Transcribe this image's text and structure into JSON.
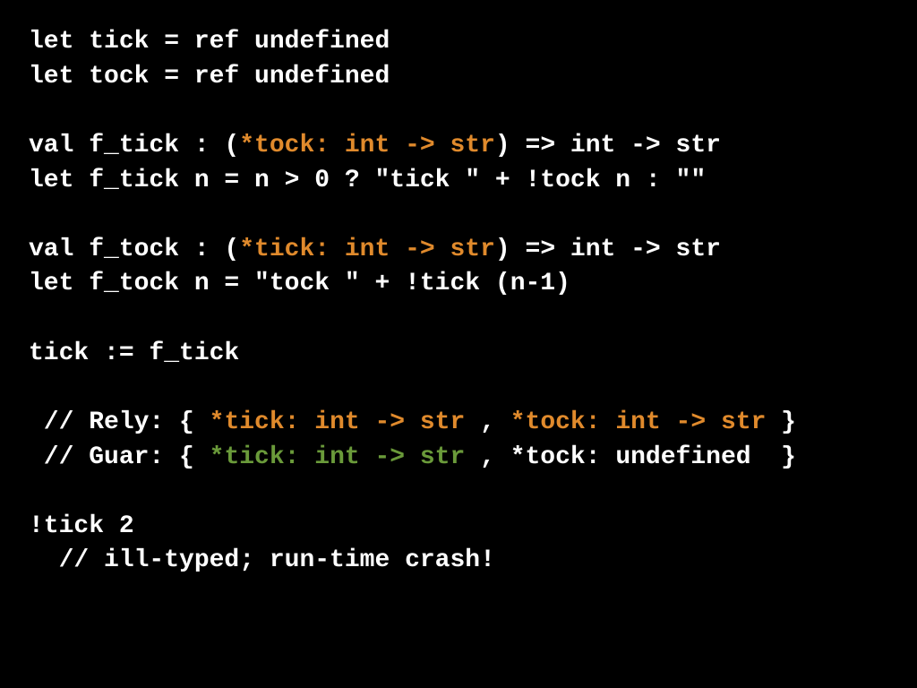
{
  "colors": {
    "bg": "#000000",
    "fg": "#ffffff",
    "orange": "#e08a2c",
    "green": "#6a9a3a"
  },
  "code": {
    "l1": "let tick = ref undefined",
    "l2": "let tock = ref undefined",
    "l3": "",
    "l4a": "val f_tick : (",
    "l4b": "*tock: int -> str",
    "l4c": ") => int -> str",
    "l5": "let f_tick n = n > 0 ? \"tick \" + !tock n : \"\"",
    "l6": "",
    "l7a": "val f_tock : (",
    "l7b": "*tick: int -> str",
    "l7c": ") => int -> str",
    "l8": "let f_tock n = \"tock \" + !tick (n-1)",
    "l9": "",
    "l10": "tick := f_tick",
    "l11": "",
    "l12a": " // Rely: { ",
    "l12b": "*tick: int -> str",
    "l12c": " , ",
    "l12d": "*tock: int -> str",
    "l12e": " }",
    "l13a": " // Guar: { ",
    "l13b": "*tick: int -> str",
    "l13c": " , *tock: undefined  }",
    "l14": "",
    "l15": "!tick 2",
    "l16": "  // ill-typed; run-time crash!"
  }
}
